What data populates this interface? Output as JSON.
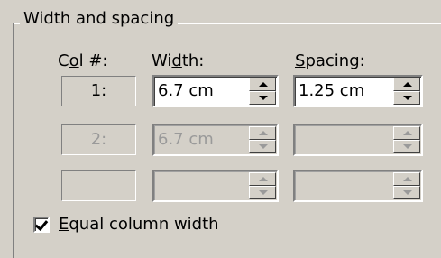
{
  "group": {
    "title": "Width and spacing"
  },
  "headers": {
    "col_prefix": "C",
    "col_under": "o",
    "col_suffix": "l #:",
    "width_prefix": "Wi",
    "width_under": "d",
    "width_suffix": "th:",
    "spacing_under": "S",
    "spacing_suffix": "pacing:"
  },
  "rows": [
    {
      "col": "1:",
      "width": "6.7 cm",
      "spacing": "1.25 cm",
      "enabled": true
    },
    {
      "col": "2:",
      "width": "6.7 cm",
      "spacing": "",
      "enabled": false
    },
    {
      "col": "",
      "width": "",
      "spacing": "",
      "enabled": false
    }
  ],
  "equal_width": {
    "prefix": "",
    "under": "E",
    "suffix": "qual column width",
    "checked": true
  }
}
